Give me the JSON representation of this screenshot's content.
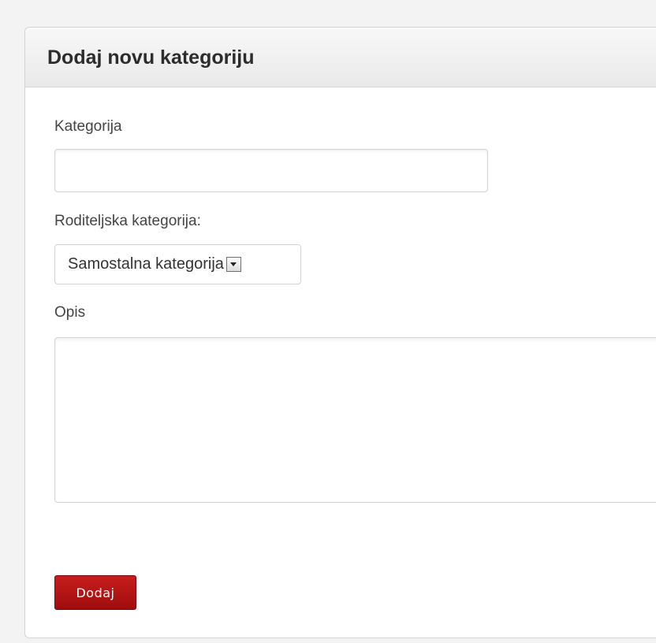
{
  "panel": {
    "title": "Dodaj novu kategoriju"
  },
  "form": {
    "category_label": "Kategorija",
    "category_value": "",
    "parent_label": "Roditeljska kategorija:",
    "parent_selected": "Samostalna kategorija",
    "description_label": "Opis",
    "description_value": "",
    "submit_label": "Dodaj"
  },
  "icons": {
    "select_arrow": "chevron-down-icon"
  },
  "colors": {
    "submit_button": "#b31414",
    "panel_header": "#eeeeee",
    "background": "#f3f3f3"
  }
}
